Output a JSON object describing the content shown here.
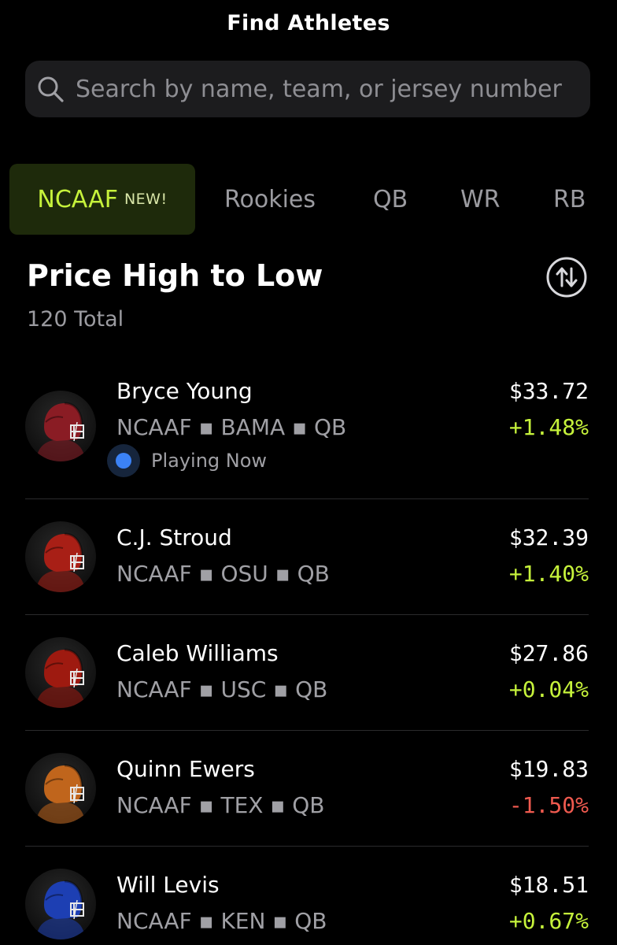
{
  "header": {
    "title": "Find Athletes"
  },
  "search": {
    "placeholder": "Search by name, team, or jersey number",
    "value": ""
  },
  "tabs": [
    {
      "label": "NCAAF",
      "badge": "NEW!",
      "active": true
    },
    {
      "label": "Rookies"
    },
    {
      "label": "QB"
    },
    {
      "label": "WR"
    },
    {
      "label": "RB"
    }
  ],
  "list": {
    "sort_label": "Price High to Low",
    "total": "120 Total",
    "athletes": [
      {
        "name": "Bryce Young",
        "league": "NCAAF",
        "team": "BAMA",
        "position": "QB",
        "price": "$33.72",
        "change": "+1.48%",
        "trend": "up",
        "status": "Playing Now",
        "helmet_color": "#8a1c24"
      },
      {
        "name": "C.J. Stroud",
        "league": "NCAAF",
        "team": "OSU",
        "position": "QB",
        "price": "$32.39",
        "change": "+1.40%",
        "trend": "up",
        "helmet_color": "#a81f16"
      },
      {
        "name": "Caleb Williams",
        "league": "NCAAF",
        "team": "USC",
        "position": "QB",
        "price": "$27.86",
        "change": "+0.04%",
        "trend": "up",
        "helmet_color": "#9e1a10"
      },
      {
        "name": "Quinn Ewers",
        "league": "NCAAF",
        "team": "TEX",
        "position": "QB",
        "price": "$19.83",
        "change": "-1.50%",
        "trend": "down",
        "helmet_color": "#c0651c"
      },
      {
        "name": "Will Levis",
        "league": "NCAAF",
        "team": "KEN",
        "position": "QB",
        "price": "$18.51",
        "change": "+0.67%",
        "trend": "up",
        "helmet_color": "#1d3fb3"
      }
    ]
  },
  "colors": {
    "accent": "#c6f23b",
    "negative": "#ef5a4f",
    "live": "#3b82f6"
  }
}
